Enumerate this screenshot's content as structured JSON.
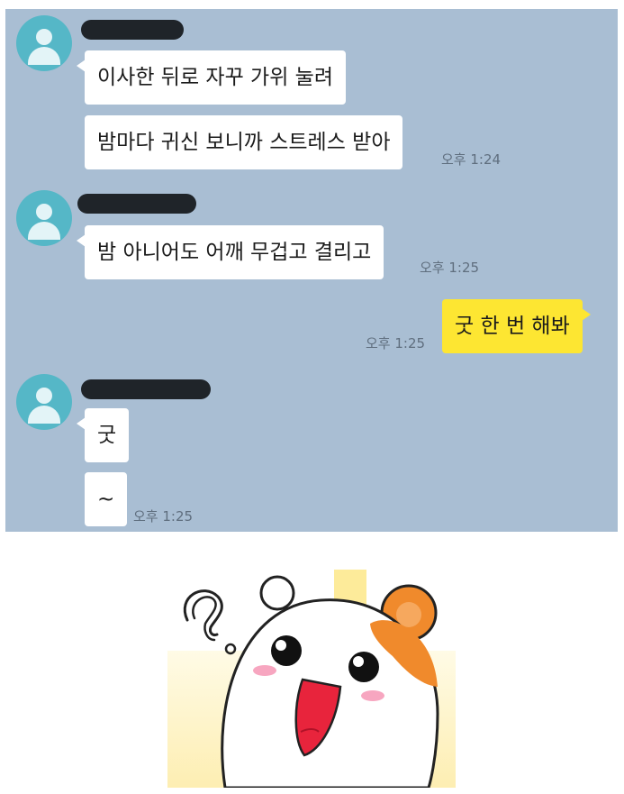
{
  "chat": {
    "messages": [
      {
        "sender": "other",
        "text": "이사한 뒤로 자꾸 가위 눌려"
      },
      {
        "sender": "other",
        "text": "밤마다 귀신 보니까 스트레스 받아",
        "time": "오후 1:24"
      },
      {
        "sender": "other",
        "text": "밤 아니어도 어깨 무겁고 결리고",
        "time": "오후 1:25"
      },
      {
        "sender": "me",
        "text": "굿 한 번 해봐",
        "time": "오후 1:25"
      },
      {
        "sender": "other",
        "text": "굿"
      },
      {
        "sender": "other",
        "text": "~",
        "time": "오후 1:25"
      }
    ]
  },
  "colors": {
    "chat_background": "#a9bed3",
    "my_bubble": "#fde632",
    "other_bubble": "#ffffff",
    "avatar": "#55b7c7"
  },
  "sticker": {
    "icon": "surprised-hamster-sticker"
  }
}
